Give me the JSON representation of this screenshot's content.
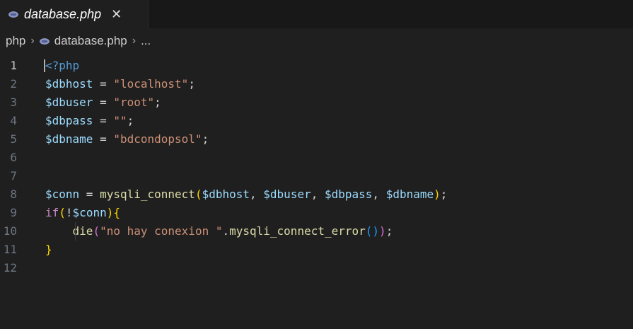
{
  "tab": {
    "title": "database.php",
    "close_glyph": "✕",
    "icon": "php-file-icon"
  },
  "breadcrumb": {
    "folder": "php",
    "file": "database.php",
    "more": "...",
    "separator": "›"
  },
  "editor": {
    "active_line": 1,
    "lines": [
      {
        "num": "1",
        "tokens": [
          {
            "t": "<?php",
            "c": "tag"
          }
        ]
      },
      {
        "num": "2",
        "tokens": [
          {
            "t": "$dbhost",
            "c": "var"
          },
          {
            "t": " = ",
            "c": "op"
          },
          {
            "t": "\"localhost\"",
            "c": "str"
          },
          {
            "t": ";",
            "c": "op"
          }
        ]
      },
      {
        "num": "3",
        "tokens": [
          {
            "t": "$dbuser",
            "c": "var"
          },
          {
            "t": " = ",
            "c": "op"
          },
          {
            "t": "\"root\"",
            "c": "str"
          },
          {
            "t": ";",
            "c": "op"
          }
        ]
      },
      {
        "num": "4",
        "tokens": [
          {
            "t": "$dbpass",
            "c": "var"
          },
          {
            "t": " = ",
            "c": "op"
          },
          {
            "t": "\"\"",
            "c": "str"
          },
          {
            "t": ";",
            "c": "op"
          }
        ]
      },
      {
        "num": "5",
        "tokens": [
          {
            "t": "$dbname",
            "c": "var"
          },
          {
            "t": " = ",
            "c": "op"
          },
          {
            "t": "\"bdcondopsol\"",
            "c": "str"
          },
          {
            "t": ";",
            "c": "op"
          }
        ]
      },
      {
        "num": "6",
        "tokens": []
      },
      {
        "num": "7",
        "tokens": []
      },
      {
        "num": "8",
        "tokens": [
          {
            "t": "$conn",
            "c": "var"
          },
          {
            "t": " = ",
            "c": "op"
          },
          {
            "t": "mysqli_connect",
            "c": "fn"
          },
          {
            "t": "(",
            "c": "br1"
          },
          {
            "t": "$dbhost",
            "c": "var"
          },
          {
            "t": ", ",
            "c": "op"
          },
          {
            "t": "$dbuser",
            "c": "var"
          },
          {
            "t": ", ",
            "c": "op"
          },
          {
            "t": "$dbpass",
            "c": "var"
          },
          {
            "t": ", ",
            "c": "op"
          },
          {
            "t": "$dbname",
            "c": "var"
          },
          {
            "t": ")",
            "c": "br1"
          },
          {
            "t": ";",
            "c": "op"
          }
        ]
      },
      {
        "num": "9",
        "tokens": [
          {
            "t": "if",
            "c": "kw"
          },
          {
            "t": "(",
            "c": "br1"
          },
          {
            "t": "!",
            "c": "bang"
          },
          {
            "t": "$conn",
            "c": "var"
          },
          {
            "t": ")",
            "c": "br1"
          },
          {
            "t": "{",
            "c": "br1"
          }
        ]
      },
      {
        "num": "10",
        "tokens": [
          {
            "t": "    ",
            "c": "op"
          },
          {
            "t": "die",
            "c": "fn"
          },
          {
            "t": "(",
            "c": "br2"
          },
          {
            "t": "\"no hay conexion \"",
            "c": "str"
          },
          {
            "t": ".",
            "c": "op"
          },
          {
            "t": "mysqli_connect_error",
            "c": "fn"
          },
          {
            "t": "(",
            "c": "br3"
          },
          {
            "t": ")",
            "c": "br3"
          },
          {
            "t": ")",
            "c": "br2"
          },
          {
            "t": ";",
            "c": "op"
          }
        ]
      },
      {
        "num": "11",
        "tokens": [
          {
            "t": "}",
            "c": "br1"
          }
        ]
      },
      {
        "num": "12",
        "tokens": []
      }
    ]
  },
  "colors": {
    "background": "#1f1f1f",
    "tabbar": "#181818",
    "variable": "#9cdcfe",
    "string": "#ce9178",
    "function": "#dcdcaa",
    "keyword": "#c586c0",
    "tag": "#569cd6"
  }
}
